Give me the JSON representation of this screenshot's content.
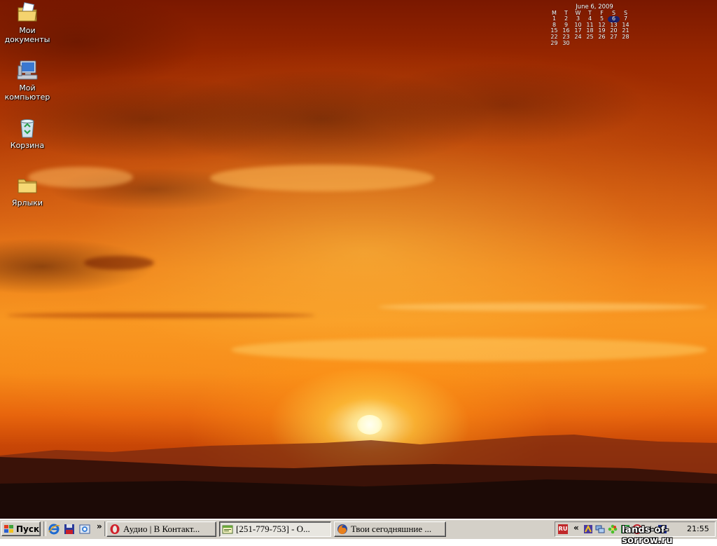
{
  "desktop": {
    "icons": [
      {
        "label_line1": "Мои",
        "label_line2": "документы",
        "icon": "my-documents-icon"
      },
      {
        "label_line1": "Мой",
        "label_line2": "компьютер",
        "icon": "my-computer-icon"
      },
      {
        "label_line1": "Корзина",
        "label_line2": "",
        "icon": "recycle-bin-icon"
      },
      {
        "label_line1": "Ярлыки",
        "label_line2": "",
        "icon": "folder-icon"
      }
    ]
  },
  "calendar": {
    "title": "June 6, 2009",
    "weekdays": [
      "M",
      "T",
      "W",
      "T",
      "F",
      "S",
      "S"
    ],
    "rows": [
      [
        "1",
        "2",
        "3",
        "4",
        "5",
        "6",
        "7"
      ],
      [
        "8",
        "9",
        "10",
        "11",
        "12",
        "13",
        "14"
      ],
      [
        "15",
        "16",
        "17",
        "18",
        "19",
        "20",
        "21"
      ],
      [
        "22",
        "23",
        "24",
        "25",
        "26",
        "27",
        "28"
      ],
      [
        "29",
        "30",
        "",
        "",
        "",
        "",
        ""
      ]
    ],
    "today": "6"
  },
  "taskbar": {
    "start_label": "Пуск",
    "quick_launch": [
      "internet-explorer-icon",
      "save-icon",
      "outlook-icon"
    ],
    "overflow_chevron": "»",
    "tasks": [
      {
        "label": "Аудио | В Контакт...",
        "icon": "opera-icon",
        "active": false
      },
      {
        "label": "[251-779-753] - О...",
        "icon": "icq-window-icon",
        "active": true
      },
      {
        "label": "Твои сегодняшние ...",
        "icon": "firefox-icon",
        "active": false
      }
    ]
  },
  "tray": {
    "language": "RU",
    "expand_chevron": "«",
    "icons": [
      "winamp-icon",
      "network-icon",
      "icq-flower-icon",
      "green-app-icon",
      "antivirus-icon",
      "volume-icon",
      "ru-app-icon"
    ],
    "clock": "21:55"
  },
  "watermark": "lands-of-sorrow.ru",
  "colors": {
    "taskbar": "#d4d0c8",
    "sky_top": "#7a1800",
    "sky_glow": "#f79520"
  }
}
